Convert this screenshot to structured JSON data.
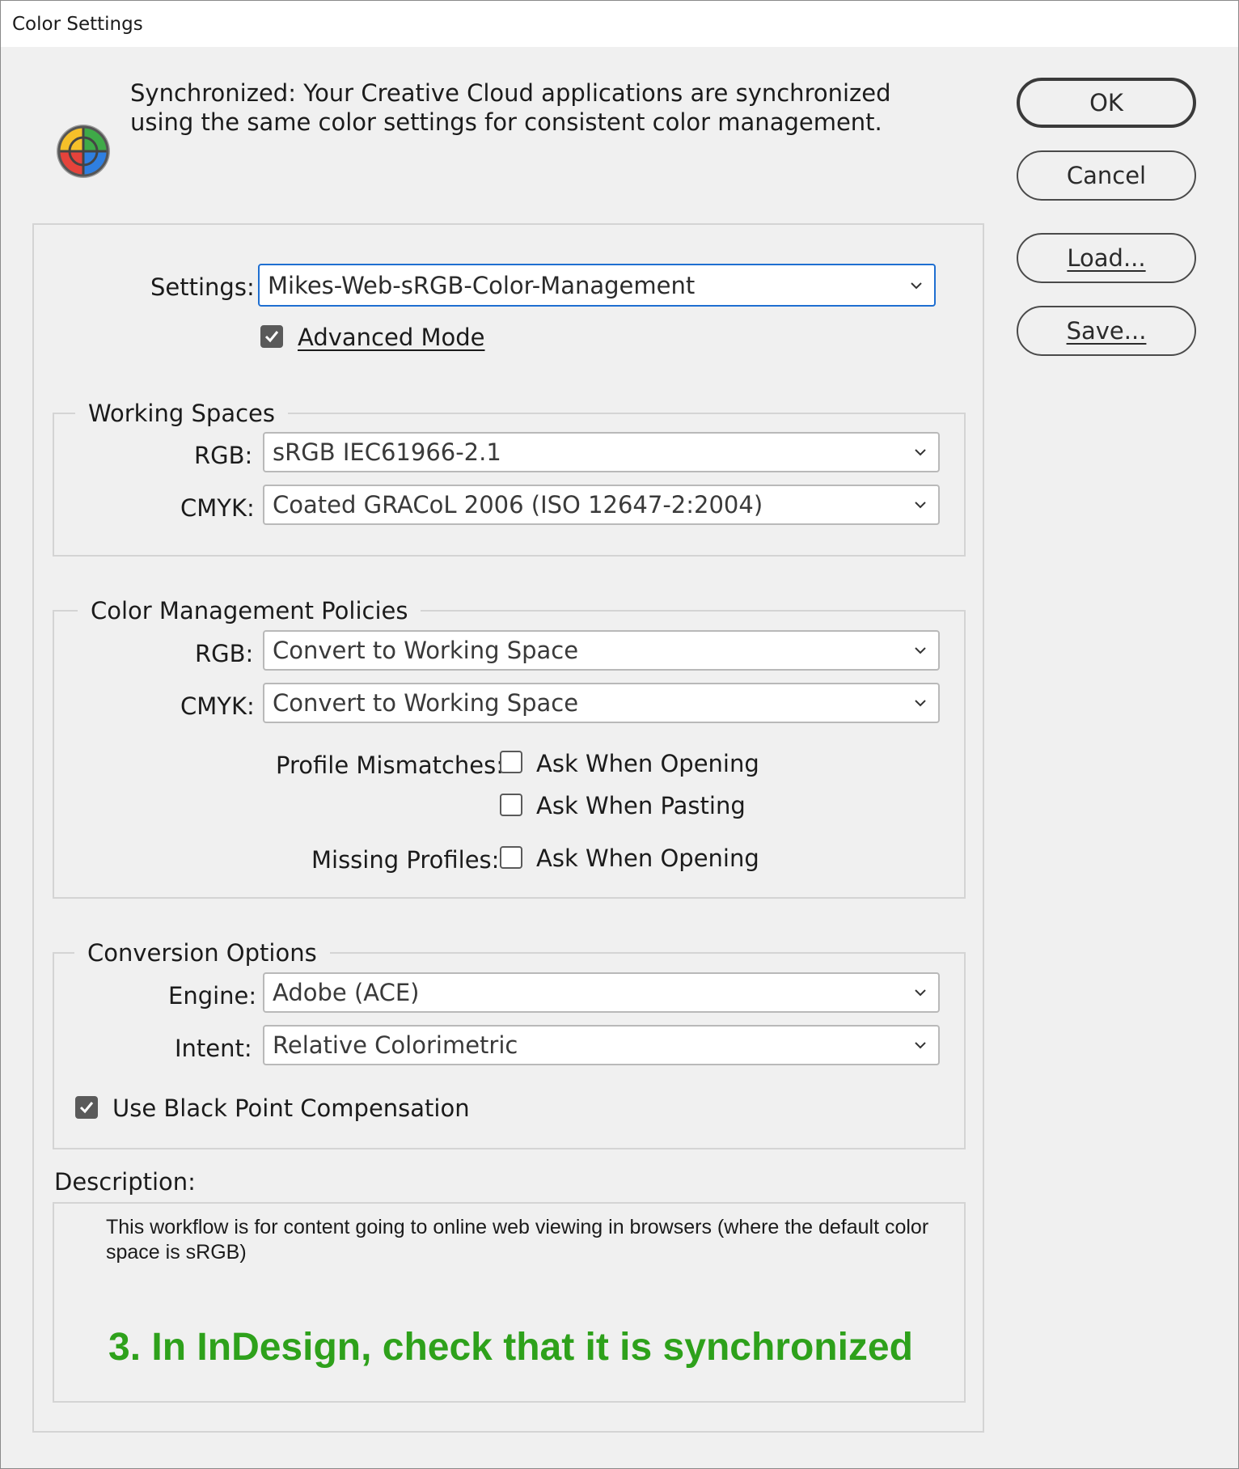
{
  "window": {
    "title": "Color Settings"
  },
  "sync": {
    "message": "Synchronized: Your Creative Cloud applications are synchronized using the same color settings for consistent color management.",
    "icon": "color-wheel-icon"
  },
  "buttons": {
    "ok": "OK",
    "cancel": "Cancel",
    "load": "Load...",
    "save": "Save..."
  },
  "settings": {
    "label": "Settings:",
    "value": "Mikes-Web-sRGB-Color-Management",
    "advanced_mode_label": "Advanced Mode",
    "advanced_mode_checked": true
  },
  "working_spaces": {
    "title": "Working Spaces",
    "rgb_label": "RGB:",
    "rgb_value": "sRGB IEC61966-2.1",
    "cmyk_label": "CMYK:",
    "cmyk_value": "Coated GRACoL 2006 (ISO 12647-2:2004)"
  },
  "policies": {
    "title": "Color Management Policies",
    "rgb_label": "RGB:",
    "rgb_value": "Convert to Working Space",
    "cmyk_label": "CMYK:",
    "cmyk_value": "Convert to Working Space",
    "profile_mismatches_label": "Profile Mismatches:",
    "ask_when_opening_label": "Ask When Opening",
    "ask_when_opening_checked": false,
    "ask_when_pasting_label": "Ask When Pasting",
    "ask_when_pasting_checked": false,
    "missing_profiles_label": "Missing Profiles:",
    "missing_ask_when_opening_label": "Ask When Opening",
    "missing_ask_when_opening_checked": false
  },
  "conversion": {
    "title": "Conversion Options",
    "engine_label": "Engine:",
    "engine_value": "Adobe (ACE)",
    "intent_label": "Intent:",
    "intent_value": "Relative Colorimetric",
    "bpc_label": "Use Black Point Compensation",
    "bpc_checked": true
  },
  "description": {
    "label": "Description:",
    "text": "This workflow is for content going to online web viewing in browsers (where the default color space is sRGB)"
  },
  "annotation": {
    "text": "3. In InDesign, check that it is synchronized",
    "color": "#2ea11b"
  },
  "colors": {
    "focus": "#1f6fd1",
    "panel_bg": "#f0f0f0"
  }
}
